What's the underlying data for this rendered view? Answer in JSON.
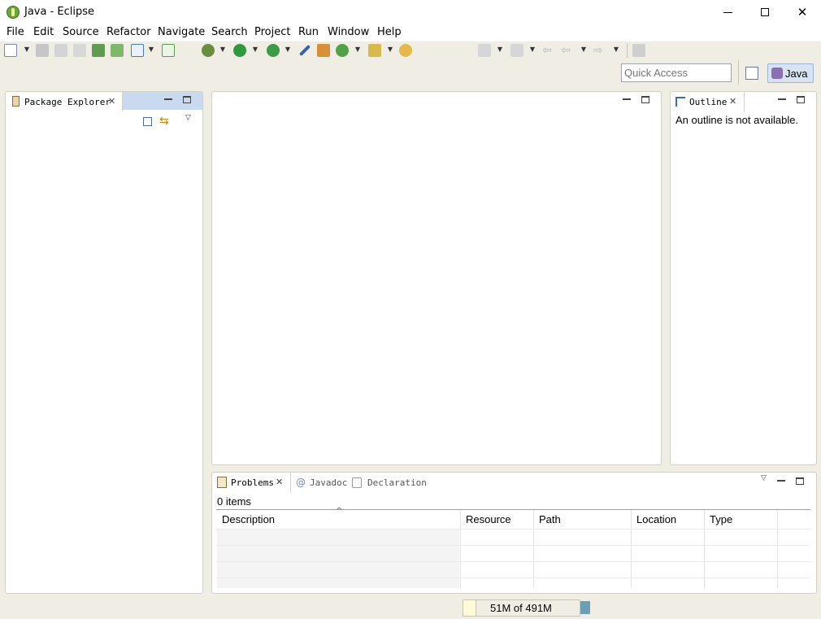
{
  "window": {
    "title": "Java - Eclipse",
    "minimize": "—",
    "maximize": "☐",
    "close": "✕"
  },
  "menu": [
    "File",
    "Edit",
    "Source",
    "Refactor",
    "Navigate",
    "Search",
    "Project",
    "Run",
    "Window",
    "Help"
  ],
  "toolbar": {
    "quick_access_placeholder": "Quick Access",
    "perspective_label": "Java"
  },
  "package_explorer": {
    "tab_label": "Package Explorer"
  },
  "outline": {
    "tab_label": "Outline",
    "message": "An outline is not available."
  },
  "bottom_panel": {
    "tabs": [
      "Problems",
      "Javadoc",
      "Declaration"
    ],
    "items_count": "0 items",
    "columns": [
      "Description",
      "Resource",
      "Path",
      "Location",
      "Type"
    ]
  },
  "status": {
    "memory": "51M of 491M"
  },
  "colors": {
    "accent_tab": "#c9d9f0",
    "perspective_active": "#d9e4f1",
    "background": "#f0ede4"
  }
}
